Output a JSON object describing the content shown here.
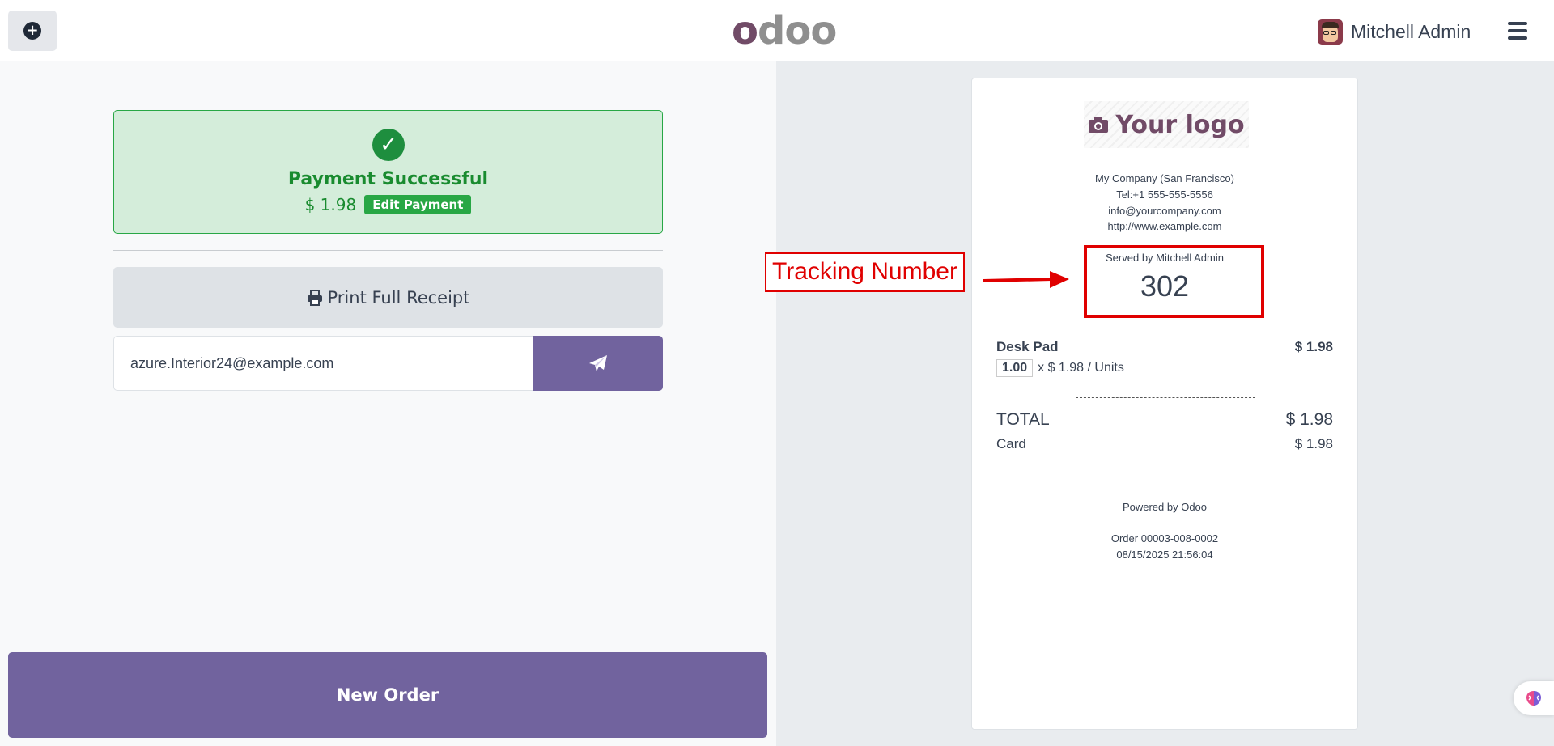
{
  "header": {
    "logo_text_o1": "o",
    "logo_text_rest": "doo",
    "user_name": "Mitchell Admin"
  },
  "payment": {
    "title": "Payment Successful",
    "amount": "$ 1.98",
    "edit_label": "Edit Payment"
  },
  "actions": {
    "print_label": "Print Full Receipt",
    "email_value": "azure.Interior24@example.com",
    "new_order_label": "New Order"
  },
  "receipt": {
    "logo_text": "Your logo",
    "company": "My Company (San Francisco)",
    "tel": "Tel:+1 555-555-5556",
    "email": "info@yourcompany.com",
    "website": "http://www.example.com",
    "served_by": "Served by Mitchell Admin",
    "tracking_number": "302",
    "line": {
      "product": "Desk Pad",
      "price": "$ 1.98",
      "qty": "1.00",
      "unit_text": "x $ 1.98 / Units"
    },
    "total_label": "TOTAL",
    "total_value": "$ 1.98",
    "payment_method": "Card",
    "payment_value": "$ 1.98",
    "powered_by": "Powered by Odoo",
    "order_ref": "Order 00003-008-0002",
    "order_date": "08/15/2025 21:56:04"
  },
  "annotation": {
    "label": "Tracking Number",
    "color": "#e00000"
  },
  "colors": {
    "primary": "#71639e",
    "success": "#28a745",
    "brand": "#714b67"
  }
}
